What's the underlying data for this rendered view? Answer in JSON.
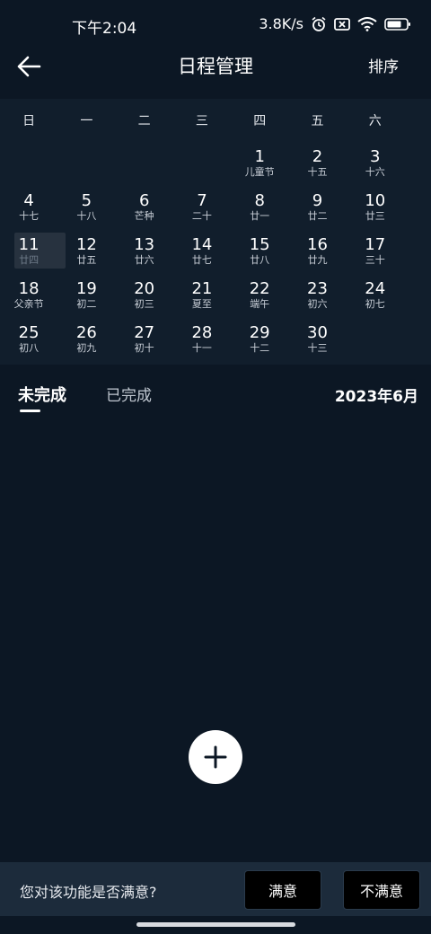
{
  "status": {
    "time": "下午2:04",
    "speed": "3.8K/s",
    "icons": [
      "alarm-icon",
      "no-sim-icon",
      "wifi-icon",
      "battery-icon"
    ]
  },
  "nav": {
    "title": "日程管理",
    "sort_label": "排序",
    "back_icon": "back-arrow-icon"
  },
  "calendar": {
    "weekdays": [
      "日",
      "一",
      "二",
      "三",
      "四",
      "五",
      "六"
    ],
    "leading_empty": 4,
    "selected_day": "11",
    "days": [
      {
        "d": "1",
        "l": "儿童节"
      },
      {
        "d": "2",
        "l": "十五"
      },
      {
        "d": "3",
        "l": "十六"
      },
      {
        "d": "4",
        "l": "十七"
      },
      {
        "d": "5",
        "l": "十八"
      },
      {
        "d": "6",
        "l": "芒种"
      },
      {
        "d": "7",
        "l": "二十"
      },
      {
        "d": "8",
        "l": "廿一"
      },
      {
        "d": "9",
        "l": "廿二"
      },
      {
        "d": "10",
        "l": "廿三"
      },
      {
        "d": "11",
        "l": "廿四"
      },
      {
        "d": "12",
        "l": "廿五"
      },
      {
        "d": "13",
        "l": "廿六"
      },
      {
        "d": "14",
        "l": "廿七"
      },
      {
        "d": "15",
        "l": "廿八"
      },
      {
        "d": "16",
        "l": "廿九"
      },
      {
        "d": "17",
        "l": "三十"
      },
      {
        "d": "18",
        "l": "父亲节"
      },
      {
        "d": "19",
        "l": "初二"
      },
      {
        "d": "20",
        "l": "初三"
      },
      {
        "d": "21",
        "l": "夏至"
      },
      {
        "d": "22",
        "l": "端午"
      },
      {
        "d": "23",
        "l": "初六"
      },
      {
        "d": "24",
        "l": "初七"
      },
      {
        "d": "25",
        "l": "初八"
      },
      {
        "d": "26",
        "l": "初九"
      },
      {
        "d": "27",
        "l": "初十"
      },
      {
        "d": "28",
        "l": "十一"
      },
      {
        "d": "29",
        "l": "十二"
      },
      {
        "d": "30",
        "l": "十三"
      }
    ]
  },
  "tabs": {
    "incomplete": "未完成",
    "complete": "已完成",
    "month": "2023年6月"
  },
  "fab": {
    "icon": "plus-icon"
  },
  "feedback": {
    "question": "您对该功能是否满意?",
    "satisfied": "满意",
    "unsatisfied": "不满意"
  },
  "colors": {
    "background": "#0c1724",
    "calendar_bg": "#111e2c",
    "feedback_bg": "#1c2b3b",
    "fab": "#ffffff"
  }
}
